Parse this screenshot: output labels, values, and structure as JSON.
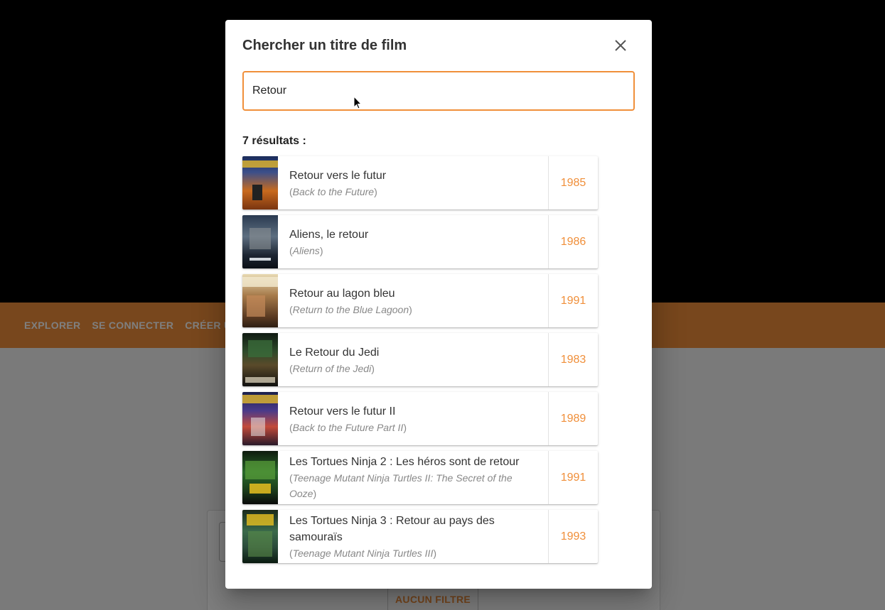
{
  "background": {
    "nav": [
      "EXPLORER",
      "SE CONNECTER",
      "CRÉER UN C"
    ],
    "filter_label": "AUCUN FILTRE"
  },
  "dialog": {
    "title": "Chercher un titre de film",
    "close_icon": "close-icon",
    "search_value": "Retour",
    "result_count": "7 résultats :"
  },
  "results": [
    {
      "title": "Retour vers le futur",
      "original": "Back to the Future",
      "year": "1985"
    },
    {
      "title": "Aliens, le retour",
      "original": "Aliens",
      "year": "1986"
    },
    {
      "title": "Retour au lagon bleu",
      "original": "Return to the Blue Lagoon",
      "year": "1991"
    },
    {
      "title": "Le Retour du Jedi",
      "original": "Return of the Jedi",
      "year": "1983"
    },
    {
      "title": "Retour vers le futur II",
      "original": "Back to the Future Part II",
      "year": "1989"
    },
    {
      "title": "Les Tortues Ninja 2 : Les héros sont de retour",
      "original": "Teenage Mutant Ninja Turtles II: The Secret of the Ooze",
      "year": "1991"
    },
    {
      "title": "Les Tortues Ninja 3 : Retour au pays des samouraïs",
      "original": "Teenage Mutant Ninja Turtles III",
      "year": "1993"
    }
  ],
  "colors": {
    "accent": "#f08f3a"
  }
}
